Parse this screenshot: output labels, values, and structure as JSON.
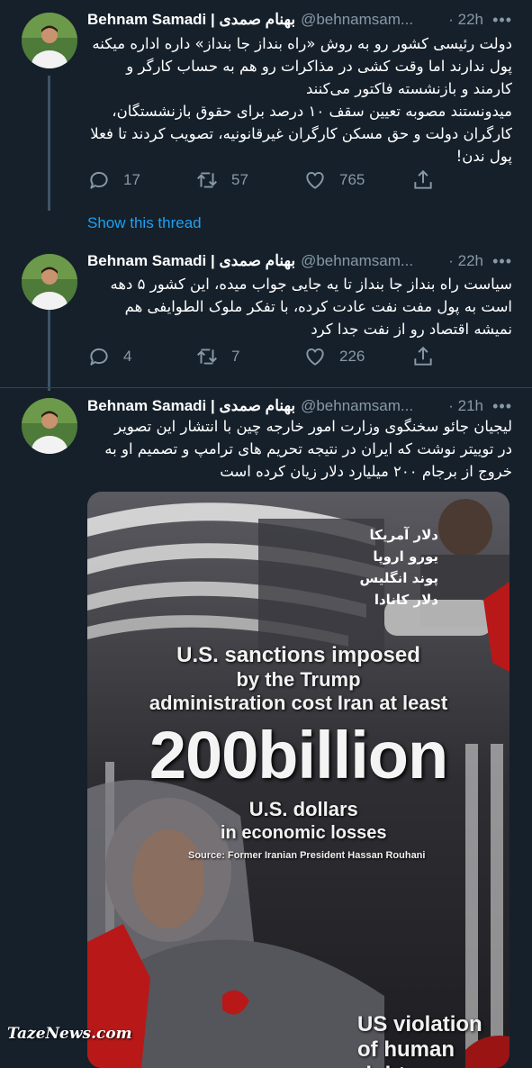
{
  "colors": {
    "background": "#15202b",
    "text": "#ffffff",
    "muted": "#8899a6",
    "link": "#1da1f2",
    "thread_line": "#3d5466"
  },
  "tweets": [
    {
      "author_name": "Behnam Samadi | بهنام صمدی",
      "handle": "@behnamsam...",
      "time": "· 22h",
      "more_icon": "more-dots-icon",
      "text": "دولت رئیسی کشور رو به روش «راه بنداز جا بنداز» داره اداره میکنه\nپول ندارند اما وقت کشی در مذاکرات رو هم به حساب کارگر و\nکارمند و بازنشسته فاکتور می‌کنند\nمیدونستند مصوبه تعیین سقف ۱۰ درصد برای حقوق بازنشستگان،\nکارگران دولت و حق مسکن کارگران غیرقانونیه، تصویب کردند تا فعلا\nپول ندن!",
      "replies": "17",
      "retweets": "57",
      "likes": "765",
      "show_thread": "Show this thread"
    },
    {
      "author_name": "Behnam Samadi | بهنام صمدی",
      "handle": "@behnamsam...",
      "time": "· 22h",
      "text": "سیاست راه بنداز جا بنداز تا یه جایی جواب میده، این کشور ۵ دهه\nاست به پول مفت نفت عادت کرده، با تفکر ملوک الطوایفی هم\nنمیشه اقتصاد رو از نفت جدا کرد",
      "replies": "4",
      "retweets": "7",
      "likes": "226"
    },
    {
      "author_name": "Behnam Samadi | بهنام صمدی",
      "handle": "@behnamsam...",
      "time": "· 21h",
      "text": "لیجیان جائو سخنگوی وزارت امور خارجه  چین با انتشار این تصویر\nدر توییتر نوشت که ایران در نتیجه تحریم های ترامپ و تصمیم او به\nخروج از برجام ۲۰۰ میلیارد دلار زیان کرده است",
      "image": {
        "rate_labels": [
          "دلار آمریکا",
          "یورو اروپا",
          "پوند انگلیس",
          "دلار کانادا"
        ],
        "headline": [
          "U.S. sanctions imposed",
          "by the Trump",
          "administration cost Iran at least"
        ],
        "big_number": "200billion",
        "sub": [
          "U.S. dollars",
          "in economic losses"
        ],
        "source": "Source: Former Iranian President Hassan Rouhani",
        "bottom": [
          "US violation",
          "of human rights"
        ]
      }
    }
  ],
  "watermark": "TazeNews.com"
}
